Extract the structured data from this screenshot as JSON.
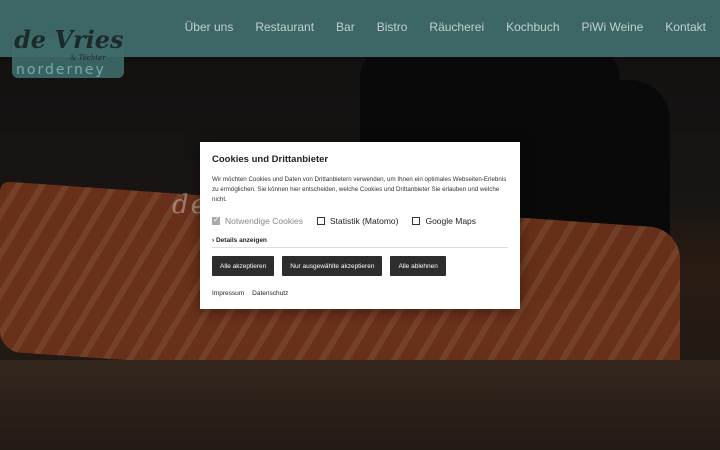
{
  "logo": {
    "line1": "de Vries",
    "line2": "& Töchter",
    "line3": "norderney"
  },
  "nav": {
    "items": [
      {
        "label": "Über uns"
      },
      {
        "label": "Restaurant"
      },
      {
        "label": "Bar"
      },
      {
        "label": "Bistro"
      },
      {
        "label": "Räucherei"
      },
      {
        "label": "Kochbuch"
      },
      {
        "label": "PiWi Weine"
      },
      {
        "label": "Kontakt"
      }
    ]
  },
  "hero": {
    "script_text": "de ... a"
  },
  "cookie_dialog": {
    "title": "Cookies und Drittanbieter",
    "description": "Wir möchten Cookies und Daten von Drittanbietern verwenden, um Ihnen ein optimales Webseiten-Erlebnis zu ermöglichen. Sie können hier entscheiden, welche Cookies und Drittanbieter Sie erlauben und welche nicht.",
    "options": [
      {
        "label": "Notwendige Cookies",
        "checked": true,
        "disabled": true
      },
      {
        "label": "Statistik (Matomo)",
        "checked": false,
        "disabled": false
      },
      {
        "label": "Google Maps",
        "checked": false,
        "disabled": false
      }
    ],
    "details_toggle": "› Details anzeigen",
    "buttons": {
      "accept_all": "Alle akzeptieren",
      "accept_selected": "Nur ausgewählte akzeptieren",
      "reject_all": "Alle ablehnen"
    },
    "links": {
      "imprint": "Impressum",
      "privacy": "Datenschutz"
    }
  },
  "colors": {
    "header_bg": "#3f6b6a",
    "logo_accent": "#6fb0ad",
    "button_bg": "#2d2d2d"
  }
}
